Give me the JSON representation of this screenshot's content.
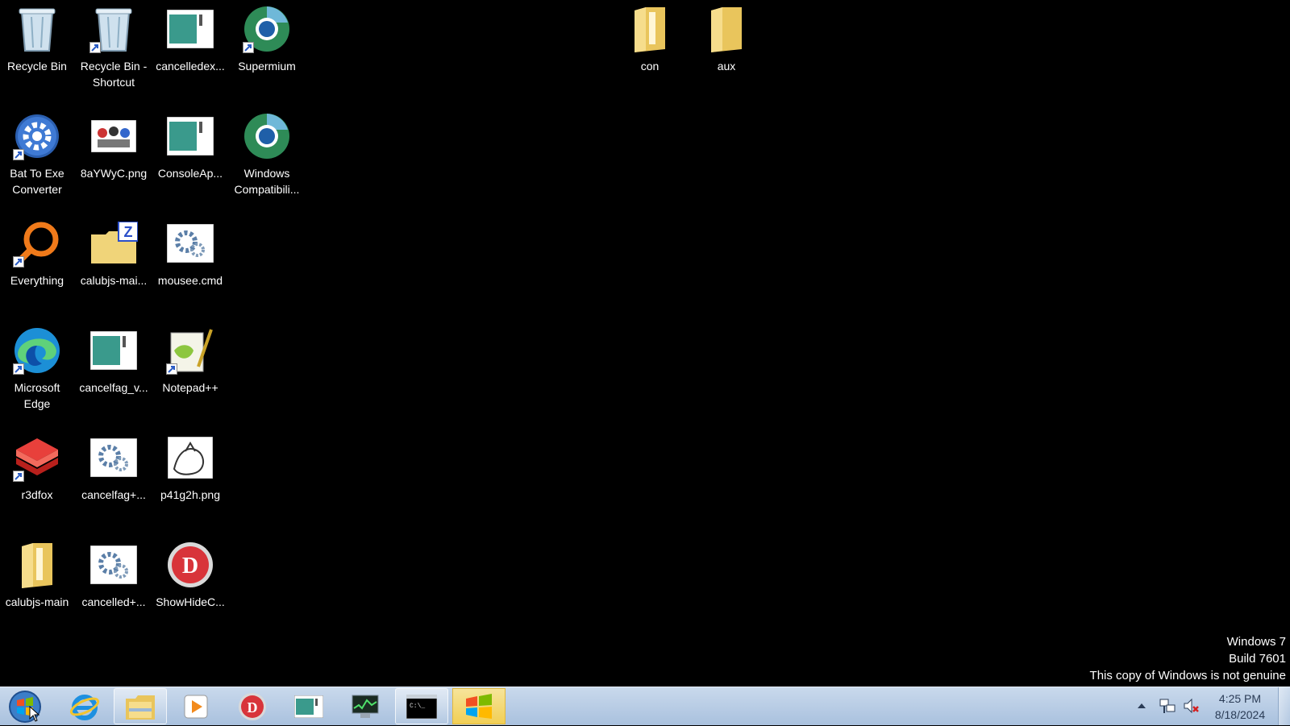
{
  "desktop": {
    "icons": {
      "recycle_bin": "Recycle Bin",
      "recycle_bin_shortcut": "Recycle Bin - Shortcut",
      "cancelledex": "cancelledex...",
      "supermium": "Supermium",
      "bat_to_exe": "Bat To Exe Converter",
      "png_8ay": "8aYWyC.png",
      "consoleap": "ConsoleAp...",
      "windows_compat": "Windows Compatibili...",
      "everything": "Everything",
      "calubjs_zip": "calubjs-mai...",
      "mousee": "mousee.cmd",
      "edge": "Microsoft Edge",
      "cancelfag_v": "cancelfag_v...",
      "notepadpp": "Notepad++",
      "r3dfox": "r3dfox",
      "cancelfag_plus": "cancelfag+...",
      "p41g2h": "p41g2h.png",
      "calubjs_main": "calubjs-main",
      "cancelled_plus": "cancelled+...",
      "showhide": "ShowHideC...",
      "con": "con",
      "aux": "aux"
    }
  },
  "watermark": {
    "line1": "Windows 7",
    "line2": "Build 7601",
    "line3": "This copy of Windows is not genuine"
  },
  "taskbar": {
    "pinned": [
      "internet-explorer",
      "windows-explorer",
      "media-player",
      "showhide-app",
      "console-app",
      "task-manager",
      "command-prompt",
      "windows-flag-app"
    ],
    "clock": {
      "time": "4:25 PM",
      "date": "8/18/2024"
    }
  },
  "colors": {
    "desktop_bg": "#000000",
    "taskbar_top": "#c9d9ec",
    "taskbar_bottom": "#a9c1de",
    "folder": "#f3d77a"
  }
}
